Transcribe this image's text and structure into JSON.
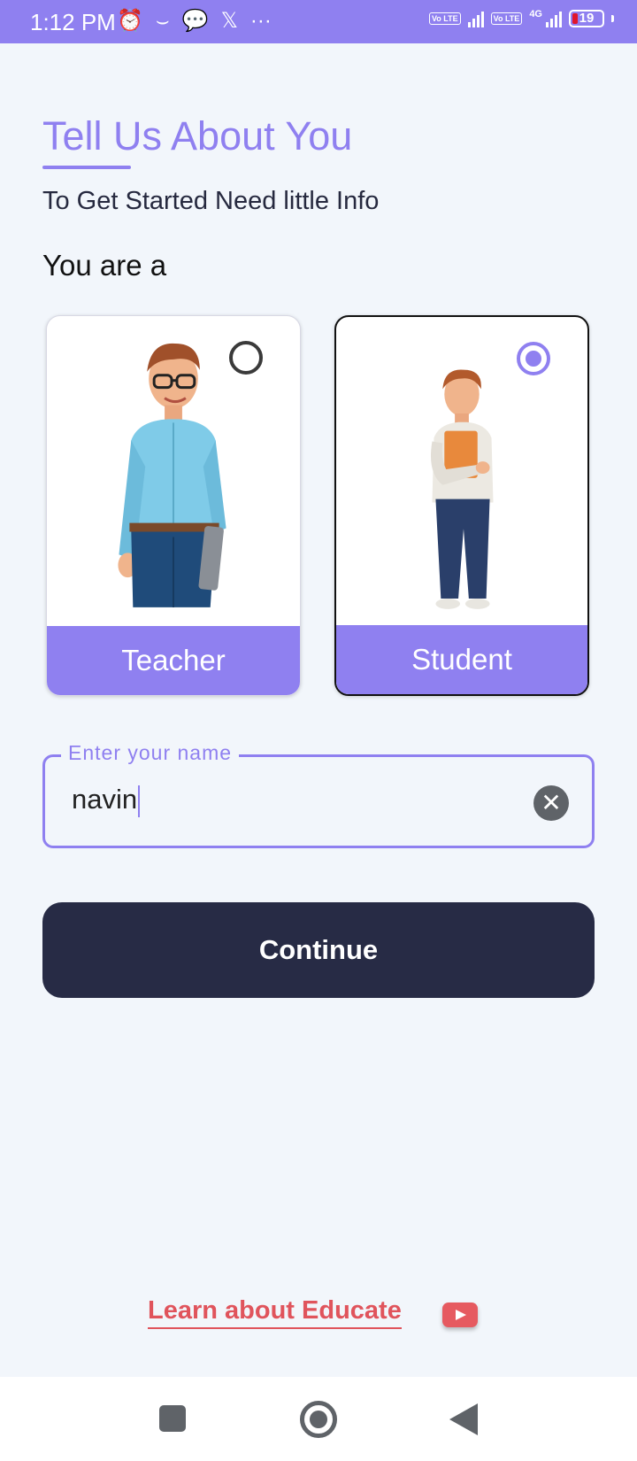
{
  "status_bar": {
    "time": "1:12 PM",
    "left_icons": [
      "alarm-icon",
      "amazon-icon",
      "messenger-icon",
      "x-icon",
      "more-dots-icon"
    ],
    "volte_1": "Vo LTE",
    "volte_2": "Vo LTE",
    "network": "4G",
    "battery": "19"
  },
  "header": {
    "title": "Tell Us About You",
    "subtitle": "To Get Started Need little Info",
    "role_prompt": "You are a"
  },
  "roles": [
    {
      "label": "Teacher",
      "selected": false
    },
    {
      "label": "Student",
      "selected": true
    }
  ],
  "name_field": {
    "label": "Enter your name",
    "value": "navin"
  },
  "continue_button": {
    "label": "Continue"
  },
  "learn_link": {
    "label": "Learn about Educate",
    "icon": "youtube-icon"
  },
  "colors": {
    "accent": "#8f80f0",
    "primary_dark": "#272b45",
    "link": "#e0545c",
    "background": "#f2f6fb"
  }
}
